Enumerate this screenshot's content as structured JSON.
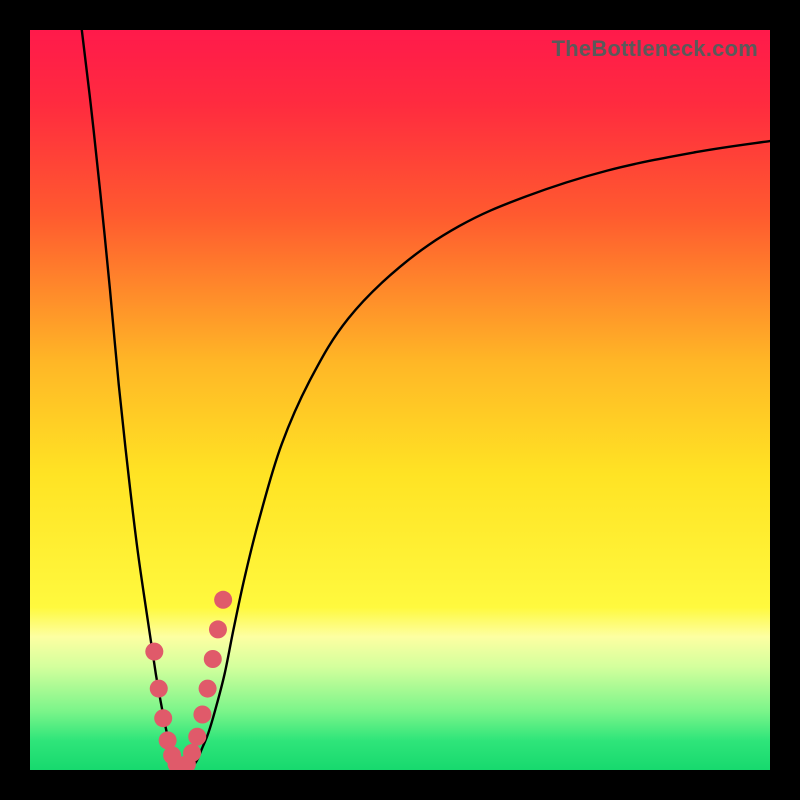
{
  "watermark": "TheBottleneck.com",
  "chart_data": {
    "type": "line",
    "title": "",
    "xlabel": "",
    "ylabel": "",
    "xlim": [
      0,
      100
    ],
    "ylim": [
      0,
      100
    ],
    "gradient_stops": [
      {
        "offset": 0.0,
        "color": "#ff1a4b"
      },
      {
        "offset": 0.1,
        "color": "#ff2b3f"
      },
      {
        "offset": 0.25,
        "color": "#ff5a2f"
      },
      {
        "offset": 0.45,
        "color": "#ffb726"
      },
      {
        "offset": 0.6,
        "color": "#ffe324"
      },
      {
        "offset": 0.78,
        "color": "#fff93e"
      },
      {
        "offset": 0.82,
        "color": "#fdffa2"
      },
      {
        "offset": 0.86,
        "color": "#d4ff9d"
      },
      {
        "offset": 0.92,
        "color": "#7cf58a"
      },
      {
        "offset": 0.96,
        "color": "#2fe57a"
      },
      {
        "offset": 1.0,
        "color": "#17d96e"
      }
    ],
    "series": [
      {
        "name": "bottleneck-curve",
        "color": "#000000",
        "x": [
          7.0,
          8.2,
          9.5,
          10.8,
          12.0,
          13.3,
          14.5,
          15.8,
          17.0,
          17.8,
          18.5,
          19.2,
          19.8,
          20.5,
          21.6,
          22.5,
          23.2,
          24.1,
          25.0,
          26.3,
          27.5,
          29.0,
          31.0,
          34.0,
          38.0,
          43.0,
          50.0,
          58.0,
          67.0,
          78.0,
          90.0,
          100.0
        ],
        "y": [
          100.0,
          90.0,
          78.0,
          65.0,
          52.0,
          40.0,
          30.0,
          21.0,
          13.0,
          8.5,
          5.0,
          2.5,
          1.0,
          0.2,
          0.2,
          1.2,
          2.8,
          5.0,
          8.0,
          13.0,
          19.0,
          26.0,
          34.0,
          44.0,
          53.0,
          61.0,
          68.0,
          73.5,
          77.5,
          81.0,
          83.5,
          85.0
        ]
      }
    ],
    "markers": {
      "name": "sample-points",
      "color": "#e05a6a",
      "radius": 9,
      "x": [
        16.8,
        17.4,
        18.0,
        18.6,
        19.2,
        19.8,
        20.5,
        21.2,
        21.9,
        22.6,
        23.3,
        24.0,
        24.7,
        25.4,
        26.1
      ],
      "y": [
        16.0,
        11.0,
        7.0,
        4.0,
        2.0,
        0.8,
        0.3,
        0.8,
        2.3,
        4.5,
        7.5,
        11.0,
        15.0,
        19.0,
        23.0
      ]
    },
    "minimum_x": 20.5
  }
}
